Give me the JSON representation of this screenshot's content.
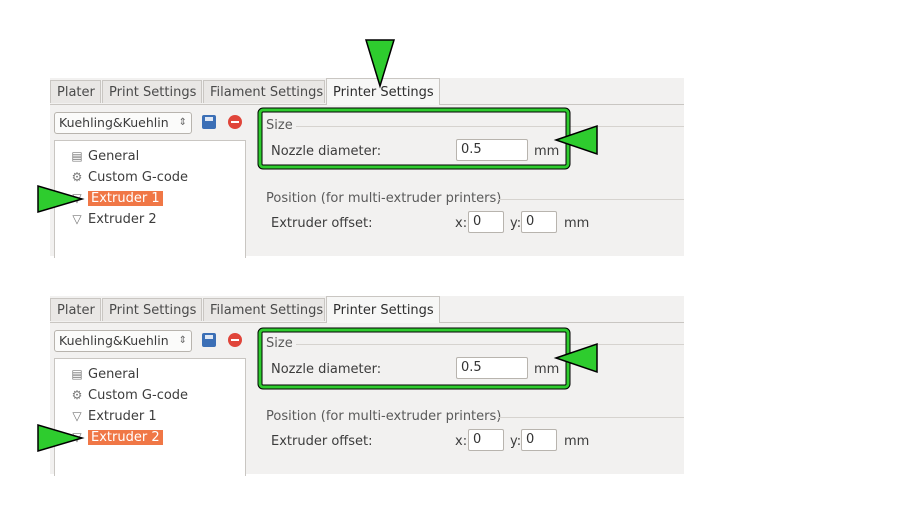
{
  "tabs": [
    "Plater",
    "Print Settings",
    "Filament Settings",
    "Printer Settings"
  ],
  "preset": "Kuehling&Kuehlin",
  "preset_spin": "⇕",
  "tree": [
    "General",
    "Custom G-code",
    "Extruder 1",
    "Extruder 2"
  ],
  "tree_icons": [
    "printer-icon",
    "gear-icon",
    "funnel-icon",
    "funnel-icon"
  ],
  "size_group": "Size",
  "nozzle_label": "Nozzle diameter:",
  "nozzle_value": "0.5",
  "unit_mm": "mm",
  "position_group": "Position (for multi-extruder printers)",
  "offset_label": "Extruder offset:",
  "x_label": "x:",
  "y_label": "y:",
  "x_value": "0",
  "y_value": "0",
  "screens": [
    {
      "selected_extruder": "Extruder 1"
    },
    {
      "selected_extruder": "Extruder 2"
    }
  ],
  "colors": {
    "highlight": "#2ecc2e",
    "selection": "#f07746",
    "annotation_arrow": "#2ecc2e"
  }
}
